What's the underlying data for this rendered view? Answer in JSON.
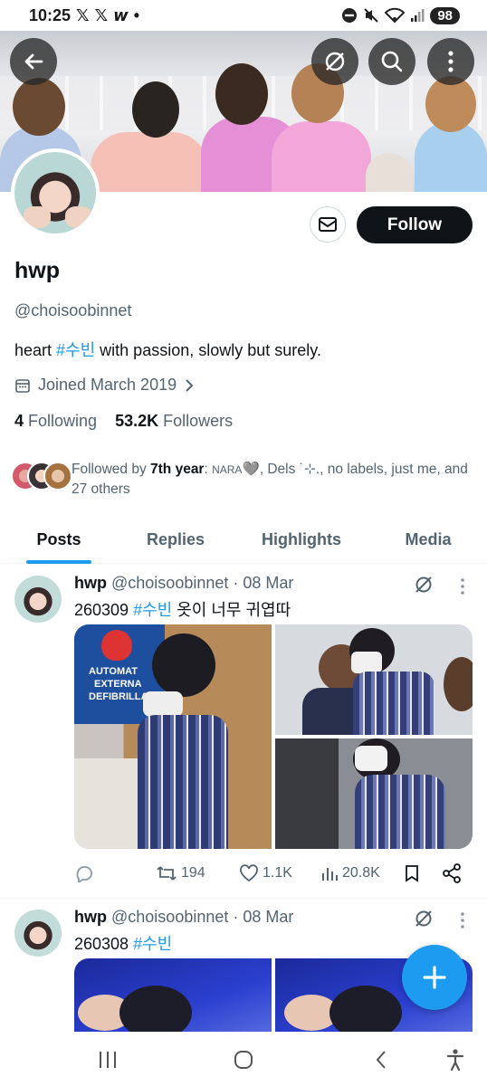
{
  "status_bar": {
    "time": "10:25",
    "notif_icons": [
      "𝕏",
      "𝕏",
      "𝙬",
      "•"
    ],
    "battery": "98"
  },
  "profile": {
    "display_name": "hwp",
    "handle": "@choisoobinnet",
    "bio_prefix": "heart ",
    "bio_hashtag": "#수빈",
    "bio_suffix": " with passion, slowly but surely.",
    "joined": "Joined March 2019",
    "following_count": "4",
    "following_label": "Following",
    "followers_count": "53.2K",
    "followers_label": "Followers",
    "follow_button": "Follow",
    "followed_by_prefix": "Followed by ",
    "followed_by_bold": "7th year",
    "followed_by_colon": ": ",
    "followed_by_nara": "NARA",
    "followed_by_rest": "🩶, Dels ˙⊹., no labels, just me, and 27 others"
  },
  "tabs": [
    "Posts",
    "Replies",
    "Highlights",
    "Media"
  ],
  "tweets": [
    {
      "name": "hwp",
      "handle": "@choisoobinnet",
      "date": "08 Mar",
      "text_prefix": "260309 ",
      "hashtag": "#수빈",
      "text_suffix": " 옷이 너무 귀엽따",
      "media_text": [
        "AUTOMAT",
        "EXTERNA",
        "DEFIBRILLATO"
      ],
      "retweets": "194",
      "likes": "1.1K",
      "views": "20.8K"
    },
    {
      "name": "hwp",
      "handle": "@choisoobinnet",
      "date": "08 Mar",
      "text_prefix": "260308 ",
      "hashtag": "#수빈",
      "text_suffix": ""
    }
  ],
  "colors": {
    "accent": "#1d9bf0",
    "text": "#0f1419",
    "secondary": "#536471",
    "follow_bg": "#0f1419"
  },
  "icons": {
    "back": "arrow-left-icon",
    "grok": "grok-icon",
    "search": "search-icon",
    "more": "more-vertical-icon",
    "mail": "mail-icon",
    "calendar": "calendar-icon",
    "compose": "plus-icon"
  }
}
